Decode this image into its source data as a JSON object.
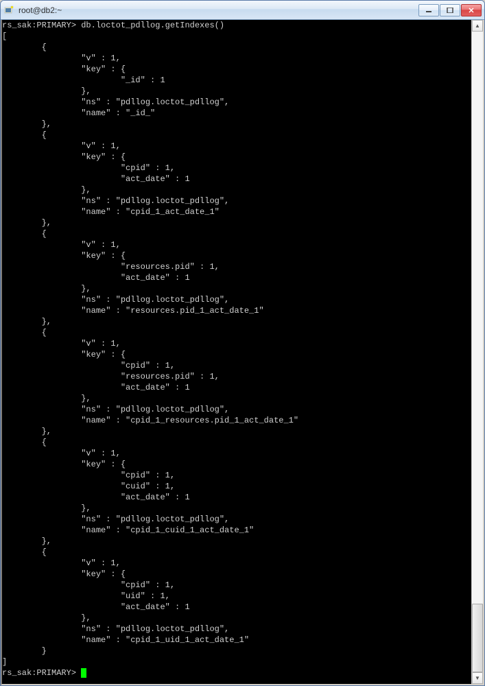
{
  "window": {
    "title": "root@db2:~"
  },
  "terminal": {
    "prompt": "rs_sak:PRIMARY>",
    "command": "db.loctot_pdllog.getIndexes()",
    "indexes": [
      {
        "v": 1,
        "key": {
          "_id": 1
        },
        "ns": "pdllog.loctot_pdllog",
        "name": "_id_"
      },
      {
        "v": 1,
        "key": {
          "cpid": 1,
          "act_date": 1
        },
        "ns": "pdllog.loctot_pdllog",
        "name": "cpid_1_act_date_1"
      },
      {
        "v": 1,
        "key": {
          "resources.pid": 1,
          "act_date": 1
        },
        "ns": "pdllog.loctot_pdllog",
        "name": "resources.pid_1_act_date_1"
      },
      {
        "v": 1,
        "key": {
          "cpid": 1,
          "resources.pid": 1,
          "act_date": 1
        },
        "ns": "pdllog.loctot_pdllog",
        "name": "cpid_1_resources.pid_1_act_date_1"
      },
      {
        "v": 1,
        "key": {
          "cpid": 1,
          "cuid": 1,
          "act_date": 1
        },
        "ns": "pdllog.loctot_pdllog",
        "name": "cpid_1_cuid_1_act_date_1"
      },
      {
        "v": 1,
        "key": {
          "cpid": 1,
          "uid": 1,
          "act_date": 1
        },
        "ns": "pdllog.loctot_pdllog",
        "name": "cpid_1_uid_1_act_date_1"
      }
    ]
  }
}
